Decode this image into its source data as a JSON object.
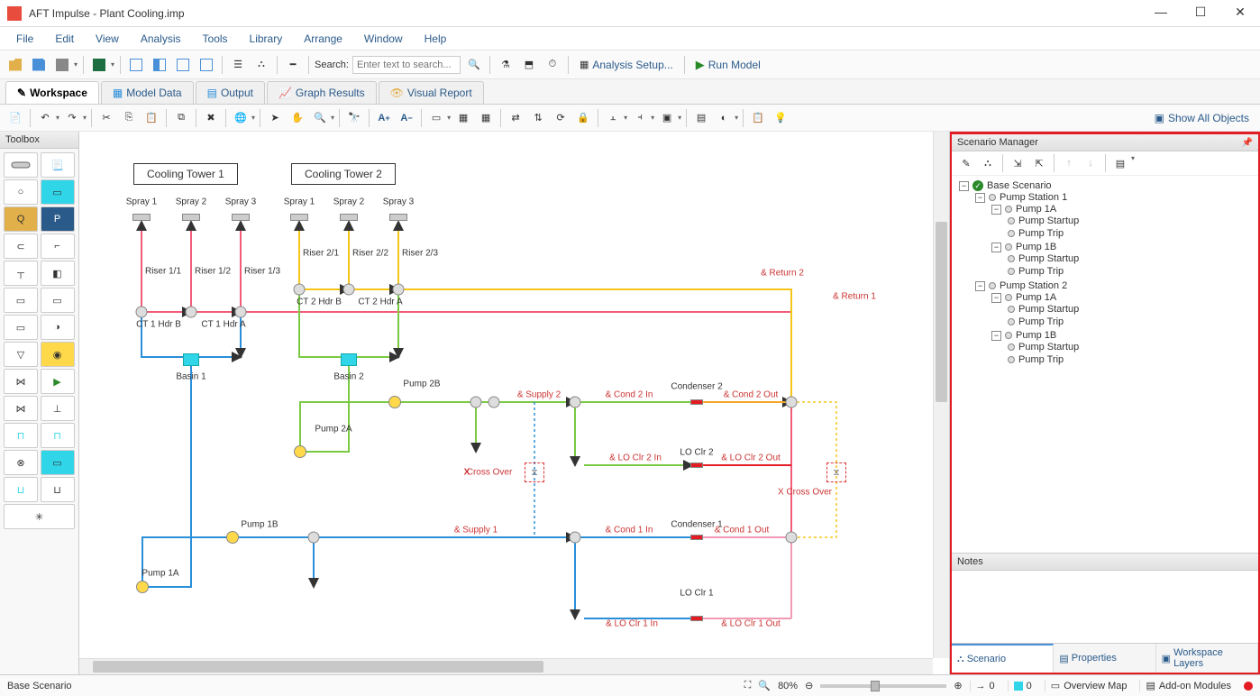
{
  "app": {
    "title": "AFT Impulse - Plant Cooling.imp"
  },
  "menu": {
    "file": "File",
    "edit": "Edit",
    "view": "View",
    "analysis": "Analysis",
    "tools": "Tools",
    "library": "Library",
    "arrange": "Arrange",
    "window": "Window",
    "help": "Help"
  },
  "toolbar": {
    "search_label": "Search:",
    "search_placeholder": "Enter text to search...",
    "analysis_setup": "Analysis Setup...",
    "run_model": "Run Model"
  },
  "tabs": {
    "workspace": "Workspace",
    "model_data": "Model Data",
    "output": "Output",
    "graph_results": "Graph Results",
    "visual_report": "Visual Report"
  },
  "subtoolbar": {
    "show_all": "Show All Objects"
  },
  "toolbox": {
    "header": "Toolbox"
  },
  "canvas": {
    "title_ct1": "Cooling Tower 1",
    "title_ct2": "Cooling Tower 2",
    "spray1": "Spray 1",
    "spray2": "Spray 2",
    "spray3": "Spray 3",
    "riser11": "Riser 1/1",
    "riser12": "Riser 1/2",
    "riser13": "Riser 1/3",
    "riser21": "Riser 2/1",
    "riser22": "Riser 2/2",
    "riser23": "Riser 2/3",
    "ct1hdra": "CT 1 Hdr A",
    "ct1hdrb": "CT 1 Hdr B",
    "ct2hdra": "CT 2 Hdr A",
    "ct2hdrb": "CT 2 Hdr B",
    "basin1": "Basin 1",
    "basin2": "Basin 2",
    "pump1a": "Pump 1A",
    "pump1b": "Pump 1B",
    "pump2a": "Pump 2A",
    "pump2b": "Pump 2B",
    "supply1": "& Supply 1",
    "supply2": "& Supply 2",
    "cond1in": "& Cond 1 In",
    "cond1out": "& Cond 1 Out",
    "cond2in": "& Cond 2 In",
    "cond2out": "& Cond 2 Out",
    "condenser1": "Condenser 1",
    "condenser2": "Condenser 2",
    "loclr1": "LO Clr 1",
    "loclr2": "LO Clr 2",
    "loclr1in": "& LO Clr 1 In",
    "loclr1out": "& LO Clr 1 Out",
    "loclr2in": "& LO Clr 2 In",
    "loclr2out": "& LO Clr 2 Out",
    "crossover": "Cross Over",
    "xcrossover": "X Cross Over",
    "return1": "& Return 1",
    "return2": "& Return 2"
  },
  "scenario": {
    "header": "Scenario Manager",
    "tree": {
      "base": "Base Scenario",
      "ps1": "Pump Station 1",
      "ps2": "Pump Station 2",
      "p1a": "Pump 1A",
      "p1b": "Pump 1B",
      "startup": "Pump Startup",
      "trip": "Pump Trip"
    },
    "notes": "Notes",
    "tabs": {
      "scenario": "Scenario",
      "properties": "Properties",
      "layers": "Workspace Layers"
    }
  },
  "status": {
    "base_scenario": "Base Scenario",
    "zoom": "80%",
    "count_arrow": "0",
    "count_box": "0",
    "overview": "Overview Map",
    "addon": "Add-on Modules"
  },
  "colors": {
    "accent": "#2a5a8a",
    "red": "#e31b23",
    "yellow": "#f5c518",
    "green": "#7ac943",
    "blue": "#2a8fd9",
    "pink": "#f299b3"
  }
}
